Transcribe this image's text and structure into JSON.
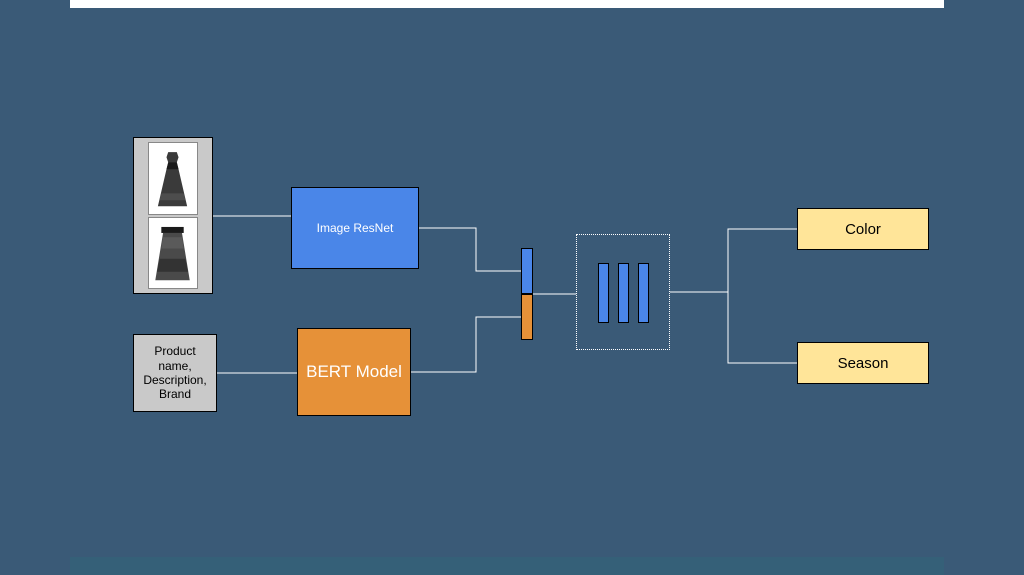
{
  "diagram": {
    "inputs": {
      "image_alt": "product dress images",
      "text": "Product name, Description, Brand"
    },
    "models": {
      "image_model": "Image ResNet",
      "text_model": "BERT Model"
    },
    "outputs": {
      "out1": "Color",
      "out2": "Season"
    }
  },
  "colors": {
    "background": "#3a5a77",
    "resnet": "#4a86e8",
    "bert": "#e69138",
    "output": "#ffe599",
    "input_bg": "#c9c9c9"
  }
}
